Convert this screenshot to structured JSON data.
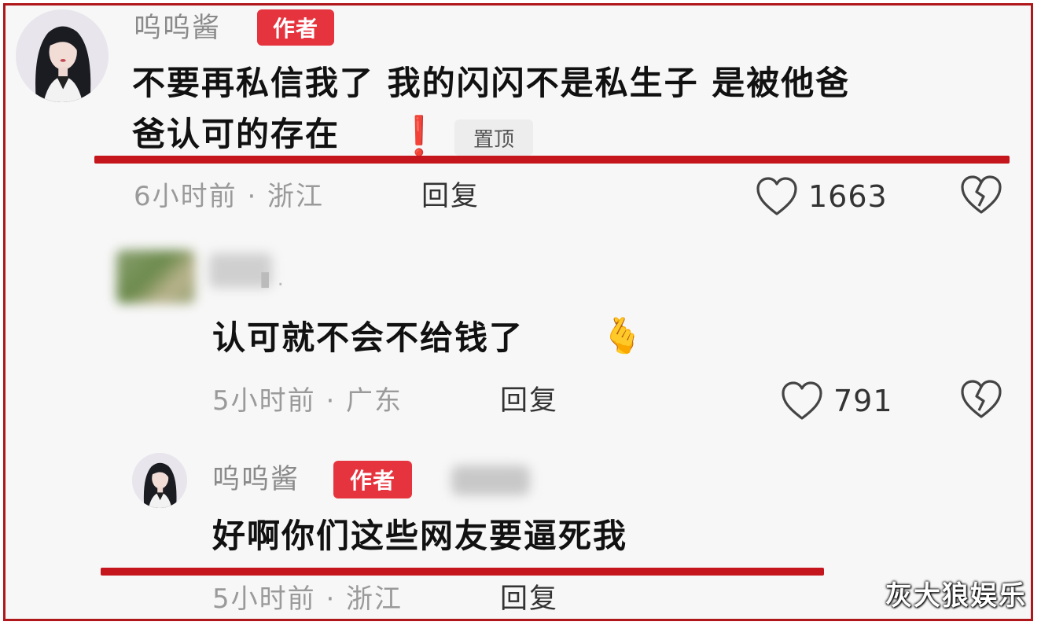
{
  "comment1": {
    "username": "呜呜酱",
    "badge": "作者",
    "text_line1": "不要再私信我了 我的闪闪不是私生子 是被他爸",
    "text_line2": "爸认可的存在",
    "exclamation": "❗",
    "pin_label": "置顶",
    "time_location": "6小时前 · 浙江",
    "reply_label": "回复",
    "like_count": "1663"
  },
  "reply1": {
    "username_blurred": "▮ .",
    "text": "认可就不会不给钱了",
    "emoji": "🫰",
    "time_location": "5小时前 · 广东",
    "reply_label": "回复",
    "like_count": "791"
  },
  "reply2": {
    "username": "呜呜酱",
    "badge": "作者",
    "text": "好啊你们这些网友要逼死我",
    "time_location": "5小时前 · 浙江",
    "reply_label": "回复"
  },
  "watermark": "灰大狼娱乐",
  "icons": {
    "like": "heart-outline-icon",
    "dislike": "broken-heart-icon"
  },
  "colors": {
    "frame_border": "#b0171b",
    "underline": "#c4161c",
    "badge": "#e6343f"
  }
}
